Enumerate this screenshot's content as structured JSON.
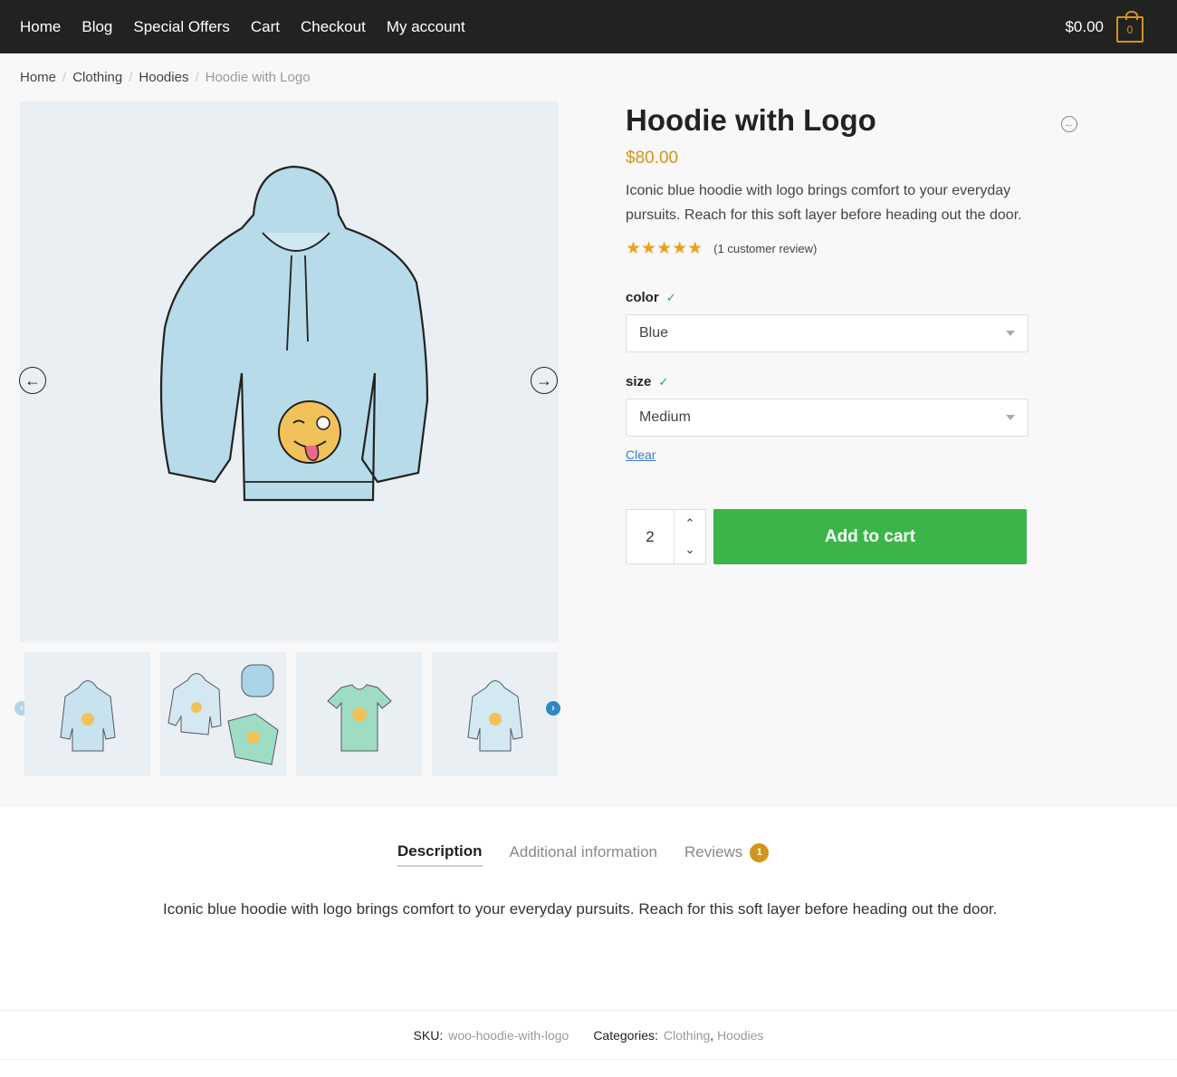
{
  "nav": {
    "items": [
      "Home",
      "Blog",
      "Special Offers",
      "Cart",
      "Checkout",
      "My account"
    ],
    "cart_total": "$0.00",
    "cart_count": "0"
  },
  "breadcrumb": [
    "Home",
    "Clothing",
    "Hoodies",
    "Hoodie with Logo"
  ],
  "gallery": {
    "main_image": "blue hoodie with winking emoji logo",
    "thumbnails": [
      "blue hoodie",
      "hoodie, beanie and t-shirt set",
      "green v-neck t-shirt",
      "blue hoodie"
    ]
  },
  "product": {
    "title": "Hoodie with Logo",
    "price": "$80.00",
    "short_description": "Iconic blue hoodie with logo brings comfort to your everyday pursuits. Reach for this soft layer before heading out the door.",
    "rating": 5,
    "rating_max": 5,
    "review_link": "(1 customer review)",
    "variations": [
      {
        "label": "color",
        "value": "Blue"
      },
      {
        "label": "size",
        "value": "Medium"
      }
    ],
    "clear_label": "Clear",
    "quantity": "2",
    "add_to_cart": "Add to cart"
  },
  "tabs": {
    "items": [
      {
        "label": "Description",
        "active": true
      },
      {
        "label": "Additional information",
        "active": false
      },
      {
        "label": "Reviews",
        "active": false,
        "count": "1"
      }
    ],
    "description": "Iconic blue hoodie with logo brings comfort to your everyday pursuits. Reach for this soft layer before heading out the door."
  },
  "meta": {
    "sku_label": "SKU:",
    "sku": "woo-hoodie-with-logo",
    "categories_label": "Categories:",
    "categories": [
      "Clothing",
      "Hoodies"
    ]
  },
  "colors": {
    "accent": "#d4941a",
    "add_to_cart": "#3bb54a",
    "topbar": "#222222"
  }
}
